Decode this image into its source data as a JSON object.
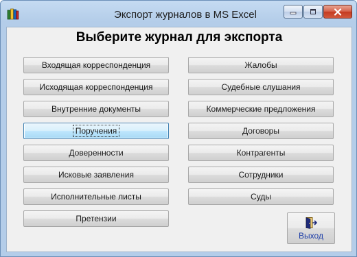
{
  "window": {
    "title": "Экспорт журналов в MS Excel"
  },
  "heading": "Выберите журнал для экспорта",
  "left_buttons": [
    {
      "label": "Входящая корреспонденция"
    },
    {
      "label": "Исходящая корреспонденция"
    },
    {
      "label": "Внутренние документы"
    },
    {
      "label": "Поручения",
      "focused": true
    },
    {
      "label": "Доверенности"
    },
    {
      "label": "Исковые заявления"
    },
    {
      "label": "Исполнительные листы"
    },
    {
      "label": "Претензии"
    }
  ],
  "right_buttons": [
    {
      "label": "Жалобы"
    },
    {
      "label": "Судебные слушания"
    },
    {
      "label": "Коммерческие предложения"
    },
    {
      "label": "Договоры"
    },
    {
      "label": "Контрагенты"
    },
    {
      "label": "Сотрудники"
    },
    {
      "label": "Суды"
    }
  ],
  "exit_button": {
    "label": "Выход",
    "icon": "exit-door-icon"
  },
  "colors": {
    "title_bar": "#b4cde9",
    "client_bg": "#f0f0f0",
    "focus_border": "#3c7fb1",
    "exit_label": "#1f3fa8",
    "close_button": "#c43a20"
  }
}
